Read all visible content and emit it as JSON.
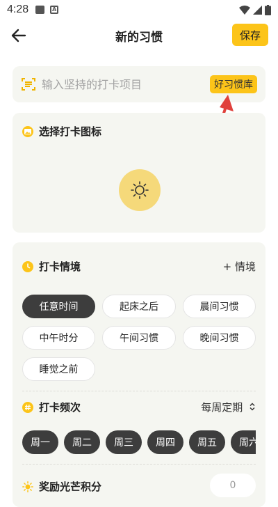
{
  "status_bar": {
    "time": "4:28"
  },
  "header": {
    "title": "新的习惯",
    "save_label": "保存"
  },
  "input": {
    "placeholder": "输入坚持的打卡项目",
    "library_button": "好习惯库"
  },
  "icon_section": {
    "title": "选择打卡图标",
    "selected_icon": "sun-icon"
  },
  "context_section": {
    "title": "打卡情境",
    "add_label": "+ 情境",
    "options": [
      "任意时间",
      "起床之后",
      "晨间习惯",
      "中午时分",
      "午间习惯",
      "晚间习惯",
      "睡觉之前"
    ],
    "selected": "任意时间"
  },
  "frequency_section": {
    "title": "打卡频次",
    "mode": "每周定期",
    "days": [
      "周一",
      "周二",
      "周三",
      "周四",
      "周五",
      "周六"
    ]
  },
  "reward_section": {
    "title": "奖励光芒积分",
    "value": "0"
  },
  "colors": {
    "accent": "#fcc419",
    "dark_chip": "#3d3d3d",
    "arrow": "#e0413c"
  }
}
